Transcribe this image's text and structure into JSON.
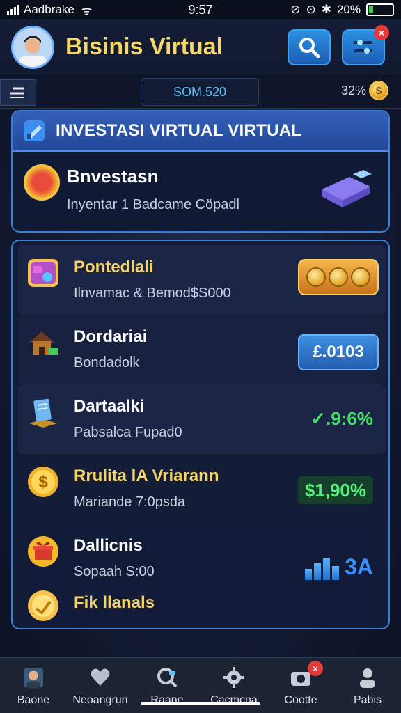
{
  "status_bar": {
    "carrier": "Aadbrake",
    "time": "9:57",
    "battery_percent": "20%",
    "battery_level": 0.2
  },
  "header": {
    "title": "Bisinis Virtual",
    "notification_badge": "×",
    "accent_color": "#2b8fe0"
  },
  "summary": {
    "balance": "SOM.520",
    "percent": "32%",
    "coin_symbol": "$"
  },
  "invest_panel": {
    "title": "INVESTASI VIRTUAL VIRTUAL",
    "item": {
      "title": "Bnvestasn",
      "subtitle": "Inyentar 1 Badcame Cöpadl"
    }
  },
  "list": {
    "items": [
      {
        "title": "Pontedlali",
        "subtitle": "Ilnvamac & Bemod$S000",
        "icon": "portfolio-icon"
      },
      {
        "title": "Dordariai",
        "subtitle": "Bondadolk",
        "value": "£.0103",
        "icon": "house-icon"
      },
      {
        "title": "Dartaalki",
        "subtitle": "Pabsalca Fupad0",
        "value": "✓.9:6%",
        "icon": "document-icon"
      },
      {
        "title": "Rrulita lA Vriarann",
        "subtitle": "Mariande 7:0psda",
        "value": "$1,90%",
        "icon": "dollar-coin-icon"
      },
      {
        "title": "Dallicnis",
        "subtitle": "Sopaah S:00",
        "value": "3A",
        "icon": "gift-icon"
      },
      {
        "title": "Fik llanals",
        "icon": "coin-hand-icon"
      }
    ]
  },
  "bottom_nav": {
    "items": [
      {
        "label": "Baone"
      },
      {
        "label": "Neoangrun"
      },
      {
        "label": "Raane"
      },
      {
        "label": "Cacmcna"
      },
      {
        "label": "Cootte",
        "badge": "×"
      },
      {
        "label": "Pabis"
      }
    ]
  }
}
